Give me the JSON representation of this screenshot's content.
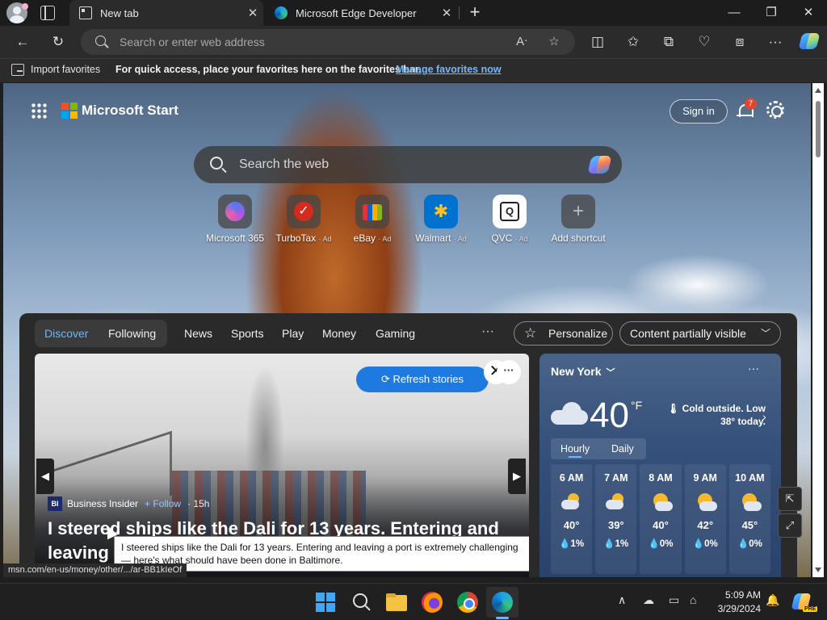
{
  "tabs": [
    {
      "title": "New tab",
      "active": true
    },
    {
      "title": "Microsoft Edge Developer",
      "active": false
    }
  ],
  "window_controls": {
    "minimize": "—",
    "restore": "❐",
    "close": "✕"
  },
  "address_bar": {
    "placeholder": "Search or enter web address"
  },
  "favorites_bar": {
    "import_label": "Import favorites",
    "tip": "For quick access, place your favorites here on the favorites bar.",
    "manage_link": "Manage favorites now"
  },
  "start": {
    "brand": "Microsoft Start",
    "sign_in": "Sign in",
    "notification_count": "7",
    "search_placeholder": "Search the web",
    "shortcuts": [
      {
        "label": "Microsoft 365",
        "ad": ""
      },
      {
        "label": "TurboTax",
        "ad": "· Ad"
      },
      {
        "label": "eBay",
        "ad": "· Ad"
      },
      {
        "label": "Walmart",
        "ad": "· Ad"
      },
      {
        "label": "QVC",
        "ad": "· Ad"
      },
      {
        "label": "Add shortcut",
        "ad": ""
      }
    ]
  },
  "feed": {
    "nav": [
      "Discover",
      "Following",
      "News",
      "Sports",
      "Play",
      "Money",
      "Gaming"
    ],
    "more": "···",
    "personalize": "Personalize",
    "visibility": "Content partially visible"
  },
  "hero": {
    "refresh": "Refresh stories",
    "source": "Business Insider",
    "source_abbr": "BI",
    "follow": "+ Follow",
    "age": "· 15h",
    "headline": "I steered ships like the Dali for 13 years. Entering and leaving",
    "tooltip": "I steered ships like the Dali for 13 years. Entering and leaving a port is extremely challenging — here's what should have been done in Baltimore."
  },
  "weather": {
    "city": "New York",
    "temp": "40",
    "unit": "°F",
    "note": "Cold outside. Low 38° today.",
    "tabs": [
      "Hourly",
      "Daily"
    ],
    "hours": [
      {
        "time": "6 AM",
        "temp": "40°",
        "precip": "1%",
        "icon": "partly-cloudy-icon"
      },
      {
        "time": "7 AM",
        "temp": "39°",
        "precip": "1%",
        "icon": "partly-cloudy-icon"
      },
      {
        "time": "8 AM",
        "temp": "40°",
        "precip": "0%",
        "icon": "partly-sunny-icon"
      },
      {
        "time": "9 AM",
        "temp": "42°",
        "precip": "0%",
        "icon": "partly-sunny-icon"
      },
      {
        "time": "10 AM",
        "temp": "45°",
        "precip": "0%",
        "icon": "partly-sunny-icon"
      }
    ]
  },
  "status_url": "msn.com/en-us/money/other/.../ar-BB1kIeOf",
  "taskbar": {
    "time": "5:09 AM",
    "date": "3/29/2024",
    "pre": "PRE"
  },
  "colors": {
    "accent": "#1f7ae0",
    "link": "#73b8ff",
    "windows_blue": "#3fa7f5"
  }
}
